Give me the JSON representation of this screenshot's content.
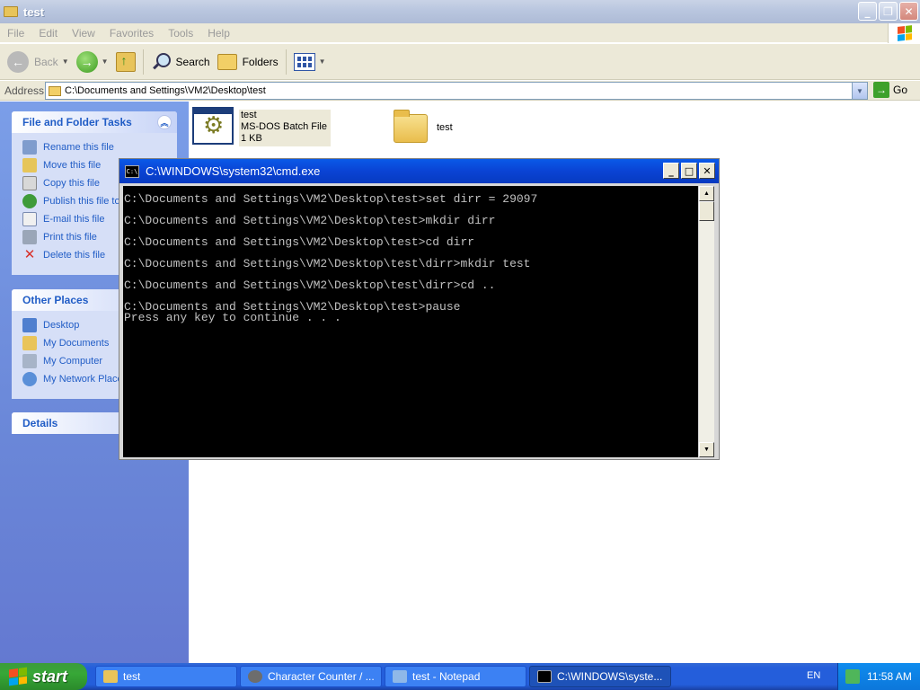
{
  "explorer": {
    "title": "test",
    "menu": [
      "File",
      "Edit",
      "View",
      "Favorites",
      "Tools",
      "Help"
    ],
    "toolbar": {
      "back": "Back",
      "search": "Search",
      "folders": "Folders"
    },
    "address": {
      "label": "Address",
      "value": "C:\\Documents and Settings\\VM2\\Desktop\\test",
      "go": "Go"
    }
  },
  "taskpane": {
    "file_tasks": {
      "title": "File and Folder Tasks",
      "items": [
        "Rename this file",
        "Move this file",
        "Copy this file",
        "Publish this file to",
        "E-mail this file",
        "Print this file",
        "Delete this file"
      ]
    },
    "other_places": {
      "title": "Other Places",
      "items": [
        "Desktop",
        "My Documents",
        "My Computer",
        "My Network Places"
      ]
    },
    "details": {
      "title": "Details"
    }
  },
  "files": [
    {
      "name": "test",
      "type": "MS-DOS Batch File",
      "size": "1 KB"
    },
    {
      "name": "test"
    }
  ],
  "cmd": {
    "title": "C:\\WINDOWS\\system32\\cmd.exe",
    "lines": [
      "C:\\Documents and Settings\\VM2\\Desktop\\test>set dirr = 29097",
      "C:\\Documents and Settings\\VM2\\Desktop\\test>mkdir dirr",
      "C:\\Documents and Settings\\VM2\\Desktop\\test>cd dirr",
      "C:\\Documents and Settings\\VM2\\Desktop\\test\\dirr>mkdir test",
      "C:\\Documents and Settings\\VM2\\Desktop\\test\\dirr>cd ..",
      "C:\\Documents and Settings\\VM2\\Desktop\\test>pause",
      "Press any key to continue . . ."
    ]
  },
  "taskbar": {
    "start": "start",
    "buttons": [
      "test",
      "Character Counter / ...",
      "test - Notepad",
      "C:\\WINDOWS\\syste..."
    ],
    "language": "EN",
    "clock": "11:58 AM"
  },
  "colors": {
    "xp_blue": "#245edb",
    "start_green": "#37a737",
    "link_blue": "#215dc6",
    "console_text": "#c0c0c0"
  },
  "icons": [
    "folder-icon",
    "back-icon",
    "forward-icon",
    "up-folder-icon",
    "search-icon",
    "folders-icon",
    "views-icon",
    "go-icon",
    "batch-file-icon",
    "windows-flag-icon",
    "cmd-icon"
  ]
}
